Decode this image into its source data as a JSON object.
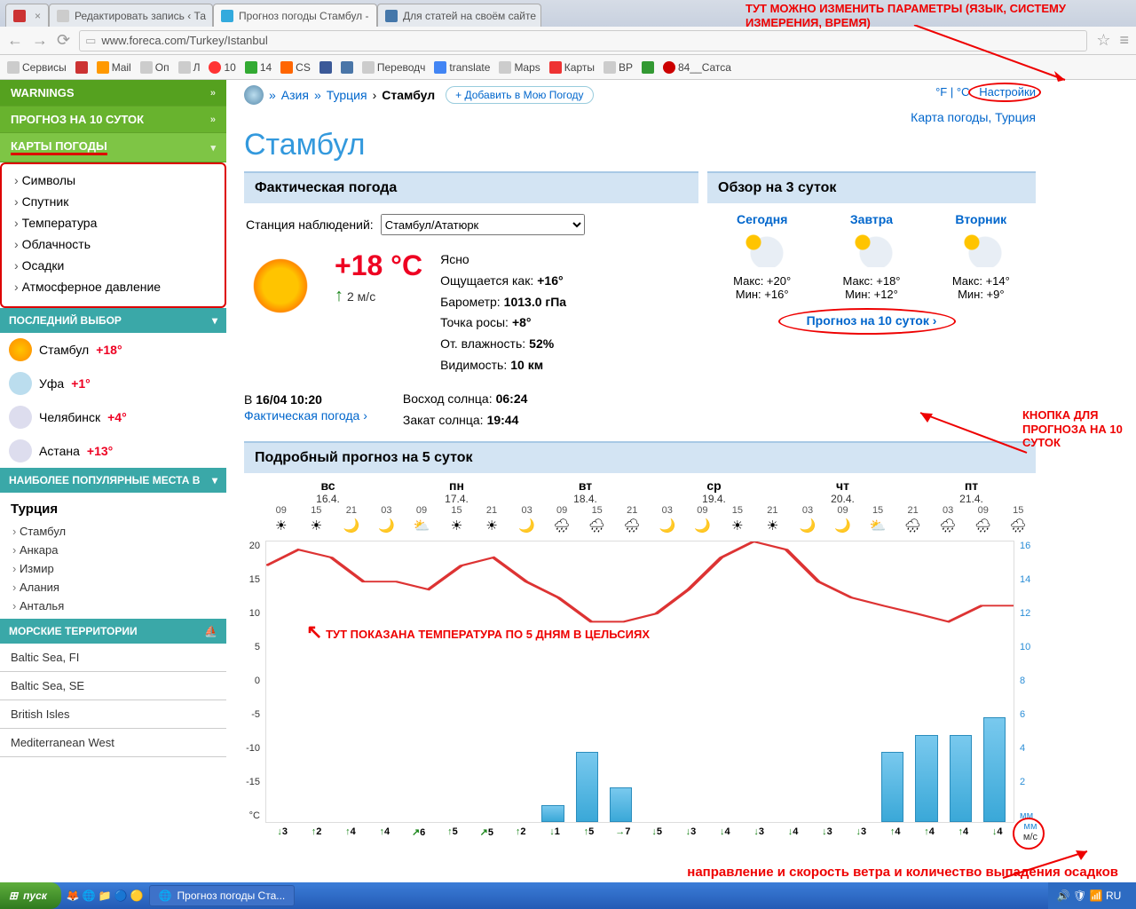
{
  "browser": {
    "tabs": [
      {
        "label": "",
        "fav": "#c00"
      },
      {
        "label": "Редактировать запись ‹ Та"
      },
      {
        "label": "Прогноз погоды Стамбул -",
        "active": true
      },
      {
        "label": "Для статей на своём сайте"
      }
    ],
    "url": "www.foreca.com/Turkey/Istanbul",
    "bookmarks": [
      "Сервисы",
      "T",
      "Mail",
      "Оп",
      "Л",
      "10",
      "14",
      "CS",
      "f",
      "vk",
      "Переводч",
      "translate",
      "Maps",
      "Карты",
      "BP",
      "",
      "84__Сатса"
    ]
  },
  "sidebar": {
    "menu": {
      "warnings": "WARNINGS",
      "ten": "ПРОГНОЗ НА 10 СУТОК",
      "maps": "КАРТЫ ПОГОДЫ"
    },
    "sub": [
      "Символы",
      "Спутник",
      "Температура",
      "Облачность",
      "Осадки",
      "Атмосферное давление"
    ],
    "recent_hd": "ПОСЛЕДНИЙ ВЫБОР",
    "recent": [
      {
        "city": "Стамбул",
        "t": "+18°",
        "c": "#e02"
      },
      {
        "city": "Уфа",
        "t": "+1°",
        "c": "#e02"
      },
      {
        "city": "Челябинск",
        "t": "+4°",
        "c": "#e02"
      },
      {
        "city": "Астана",
        "t": "+13°",
        "c": "#e02"
      }
    ],
    "pop_hd": "НАИБОЛЕЕ ПОПУЛЯРНЫЕ МЕСТА В",
    "pop_country": "Турция",
    "pop": [
      "Стамбул",
      "Анкара",
      "Измир",
      "Алания",
      "Анталья"
    ],
    "sea_hd": "МОРСКИЕ ТЕРРИТОРИИ",
    "sea": [
      "Baltic Sea, FI",
      "Baltic Sea, SE",
      "British Isles",
      "Mediterranean West"
    ]
  },
  "crumbs": {
    "asia": "Азия",
    "turkey": "Турция",
    "city": "Стамбул",
    "add": "+ Добавить в Мою Погоду"
  },
  "settings": {
    "f": "°F",
    "c": "°C",
    "link": "Настройки"
  },
  "maplink": "Карта погоды, Турция",
  "city": "Стамбул",
  "actual": {
    "hd": "Фактическая погода",
    "station_lbl": "Станция наблюдений:",
    "station": "Стамбул/Ататюрк",
    "temp": "+18 °C",
    "wind": "2 м/с",
    "cond": "Ясно",
    "rows": [
      [
        "Ощущается как:",
        "+16°"
      ],
      [
        "Барометр:",
        "1013.0 гПа"
      ],
      [
        "Точка росы:",
        "+8°"
      ],
      [
        "От. влажность:",
        "52%"
      ],
      [
        "Видимость:",
        "10 км"
      ]
    ],
    "sunrise": [
      "Восход солнца:",
      "06:24"
    ],
    "sunset": [
      "Закат солнца:",
      "19:44"
    ],
    "ts_pre": "В ",
    "ts": "16/04 10:20",
    "factlink": "Фактическая погода ›"
  },
  "over3": {
    "hd": "Обзор на 3 суток",
    "days": [
      {
        "name": "Сегодня",
        "max": "Макс: +20°",
        "min": "Мин: +16°"
      },
      {
        "name": "Завтра",
        "max": "Макс: +18°",
        "min": "Мин: +12°"
      },
      {
        "name": "Вторник",
        "max": "Макс: +14°",
        "min": "Мин: +9°"
      }
    ],
    "tenlink": "Прогноз на 10 суток ›"
  },
  "five": {
    "hd": "Подробный прогноз на 5 суток",
    "days": [
      {
        "dow": "вс",
        "date": "16.4."
      },
      {
        "dow": "пн",
        "date": "17.4."
      },
      {
        "dow": "вт",
        "date": "18.4."
      },
      {
        "dow": "ср",
        "date": "19.4."
      },
      {
        "dow": "чт",
        "date": "20.4."
      },
      {
        "dow": "пт",
        "date": "21.4."
      }
    ],
    "hours": [
      "09",
      "15",
      "21",
      "03",
      "09",
      "15",
      "21",
      "03",
      "09",
      "15",
      "21",
      "03",
      "09",
      "15",
      "21",
      "03",
      "09",
      "15",
      "21",
      "03",
      "09",
      "15"
    ],
    "wx": [
      "☀",
      "☀",
      "🌙",
      "🌙",
      "⛅",
      "☀",
      "☀",
      "🌙",
      "🌧",
      "🌧",
      "🌧",
      "🌙",
      "🌙",
      "☀",
      "☀",
      "🌙",
      "🌙",
      "⛅",
      "🌧",
      "🌧",
      "🌧",
      "🌧"
    ],
    "ylabels": [
      "20",
      "15",
      "10",
      "5",
      "0",
      "-5",
      "-10",
      "-15",
      "°C"
    ],
    "ylabels2": [
      "16",
      "14",
      "12",
      "10",
      "8",
      "6",
      "4",
      "2",
      "мм"
    ],
    "wind": [
      {
        "d": "↓",
        "v": "3"
      },
      {
        "d": "↑",
        "v": "2"
      },
      {
        "d": "↑",
        "v": "4"
      },
      {
        "d": "↑",
        "v": "4"
      },
      {
        "d": "↗",
        "v": "6"
      },
      {
        "d": "↑",
        "v": "5"
      },
      {
        "d": "↗",
        "v": "5"
      },
      {
        "d": "↑",
        "v": "2"
      },
      {
        "d": "↓",
        "v": "1"
      },
      {
        "d": "↑",
        "v": "5"
      },
      {
        "d": "→",
        "v": "7"
      },
      {
        "d": "↓",
        "v": "5"
      },
      {
        "d": "↓",
        "v": "3"
      },
      {
        "d": "↓",
        "v": "4"
      },
      {
        "d": "↓",
        "v": "3"
      },
      {
        "d": "↓",
        "v": "4"
      },
      {
        "d": "↓",
        "v": "3"
      },
      {
        "d": "↓",
        "v": "3"
      },
      {
        "d": "↑",
        "v": "4"
      },
      {
        "d": "↑",
        "v": "4"
      },
      {
        "d": "↑",
        "v": "4"
      },
      {
        "d": "↓",
        "v": "4"
      }
    ],
    "unit_mm": "мм",
    "unit_ms": "м/с"
  },
  "chart_data": {
    "type": "line+bar",
    "x_hours": [
      "09",
      "15",
      "21",
      "03",
      "09",
      "15",
      "21",
      "03",
      "09",
      "15",
      "21",
      "03",
      "09",
      "15",
      "21",
      "03",
      "09",
      "15",
      "21",
      "03",
      "09",
      "15"
    ],
    "temp_c": [
      17,
      19,
      18,
      15,
      15,
      14,
      17,
      18,
      15,
      13,
      10,
      10,
      11,
      14,
      18,
      20,
      19,
      15,
      13,
      12,
      11,
      10,
      12,
      12
    ],
    "precip_mm": [
      0,
      0,
      0,
      0,
      0,
      0,
      0,
      0,
      1,
      4,
      2,
      0,
      0,
      0,
      0,
      0,
      0,
      0,
      4,
      5,
      5,
      6
    ],
    "ylim_temp": [
      -15,
      20
    ],
    "ylim_precip": [
      0,
      16
    ],
    "wind": [
      {
        "d": "S",
        "v": 3
      },
      {
        "d": "N",
        "v": 2
      },
      {
        "d": "N",
        "v": 4
      },
      {
        "d": "N",
        "v": 4
      },
      {
        "d": "NE",
        "v": 6
      },
      {
        "d": "N",
        "v": 5
      },
      {
        "d": "NE",
        "v": 5
      },
      {
        "d": "N",
        "v": 2
      },
      {
        "d": "S",
        "v": 1
      },
      {
        "d": "N",
        "v": 5
      },
      {
        "d": "E",
        "v": 7
      },
      {
        "d": "S",
        "v": 5
      },
      {
        "d": "S",
        "v": 3
      },
      {
        "d": "S",
        "v": 4
      },
      {
        "d": "S",
        "v": 3
      },
      {
        "d": "S",
        "v": 4
      },
      {
        "d": "S",
        "v": 3
      },
      {
        "d": "S",
        "v": 3
      },
      {
        "d": "N",
        "v": 4
      },
      {
        "d": "N",
        "v": 4
      },
      {
        "d": "N",
        "v": 4
      },
      {
        "d": "S",
        "v": 4
      }
    ]
  },
  "anno": {
    "top": "ТУТ МОЖНО ИЗМЕНИТЬ ПАРАМЕТРЫ (ЯЗЫК, СИСТЕМУ ИЗМЕРЕНИЯ, ВРЕМЯ)",
    "ten": "КНОПКА ДЛЯ ПРОГНОЗА НА 10 СУТОК",
    "temp": "ТУТ ПОКАЗАНА ТЕМПЕРАТУРА ПО 5 ДНЯМ В ЦЕЛЬСИЯХ",
    "wind": "направление и скорость ветра и количество выпадения осадков"
  },
  "taskbar": {
    "start": "пуск",
    "task": "Прогноз погоды Ста..."
  }
}
